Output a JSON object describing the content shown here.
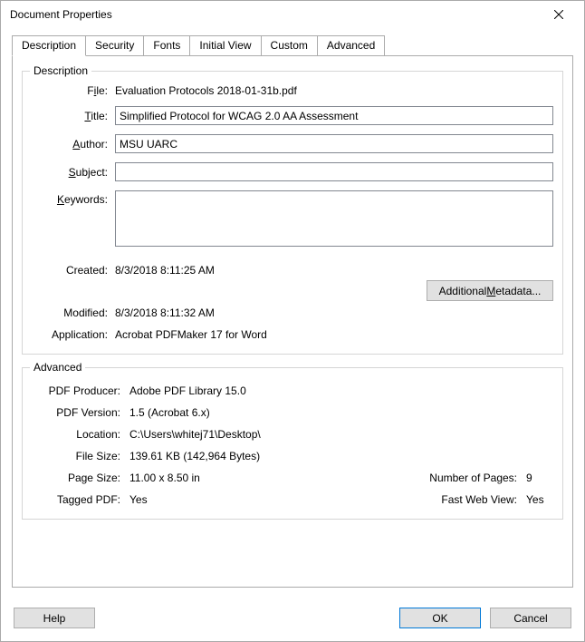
{
  "window": {
    "title": "Document Properties"
  },
  "tabs": {
    "items": [
      "Description",
      "Security",
      "Fonts",
      "Initial View",
      "Custom",
      "Advanced"
    ],
    "active": 0
  },
  "description": {
    "legend": "Description",
    "labels": {
      "file_pre": "F",
      "file_u": "i",
      "file_post": "le:",
      "title_u": "T",
      "title_post": "itle:",
      "author_u": "A",
      "author_post": "uthor:",
      "subject_u": "S",
      "subject_post": "ubject:",
      "keywords_u": "K",
      "keywords_post": "eywords:",
      "created": "Created:",
      "modified": "Modified:",
      "application": "Application:"
    },
    "file": "Evaluation Protocols 2018-01-31b.pdf",
    "title": "Simplified Protocol for WCAG 2.0 AA Assessment",
    "author": "MSU UARC",
    "subject": "",
    "keywords": "",
    "created": "8/3/2018 8:11:25 AM",
    "modified": "8/3/2018 8:11:32 AM",
    "application": "Acrobat PDFMaker 17 for Word",
    "additional_metadata_pre": "Additional ",
    "additional_metadata_u": "M",
    "additional_metadata_post": "etadata..."
  },
  "advanced": {
    "legend": "Advanced",
    "labels": {
      "producer": "PDF Producer:",
      "version": "PDF Version:",
      "location": "Location:",
      "filesize": "File Size:",
      "pagesize": "Page Size:",
      "numpages": "Number of Pages:",
      "tagged": "Tagged PDF:",
      "fastweb": "Fast Web View:"
    },
    "producer": "Adobe PDF Library 15.0",
    "version": "1.5 (Acrobat 6.x)",
    "location": "C:\\Users\\whitej71\\Desktop\\",
    "filesize": "139.61 KB (142,964 Bytes)",
    "pagesize": "11.00 x 8.50 in",
    "numpages": "9",
    "tagged": "Yes",
    "fastweb": "Yes"
  },
  "footer": {
    "help": "Help",
    "ok": "OK",
    "cancel": "Cancel"
  }
}
